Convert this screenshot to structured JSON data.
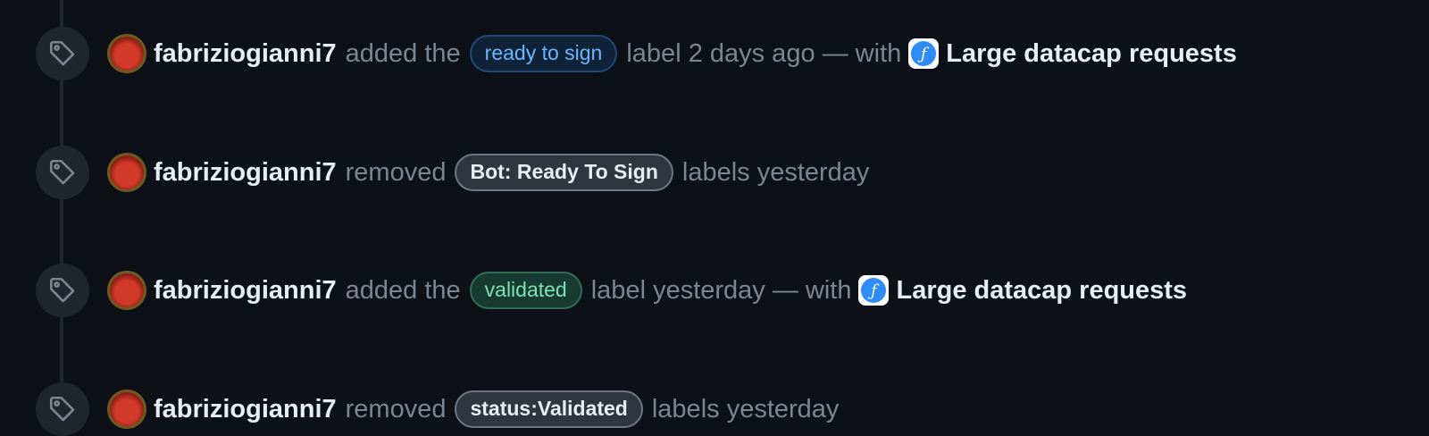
{
  "events": [
    {
      "author": "fabriziogianni7",
      "action": "added the",
      "label": "ready to sign",
      "suffix": "label 2 days ago — with",
      "app_icon": "filecoin-icon",
      "app_glyph": "ƒ",
      "app_name": "Large datacap requests"
    },
    {
      "author": "fabriziogianni7",
      "action": "removed",
      "label": "Bot: Ready To Sign",
      "suffix": "labels yesterday"
    },
    {
      "author": "fabriziogianni7",
      "action": "added the",
      "label": "validated",
      "suffix": "label yesterday — with",
      "app_icon": "filecoin-icon",
      "app_glyph": "ƒ",
      "app_name": "Large datacap requests"
    },
    {
      "author": "fabriziogianni7",
      "action": "removed",
      "label": "status:Validated",
      "suffix": "labels yesterday"
    }
  ],
  "colors": {
    "background": "#0d1117",
    "label_blue": "#6cb6ff",
    "label_green": "#7ee2b8",
    "label_gray": "#30363d",
    "app_icon": "#2f8cf5"
  }
}
